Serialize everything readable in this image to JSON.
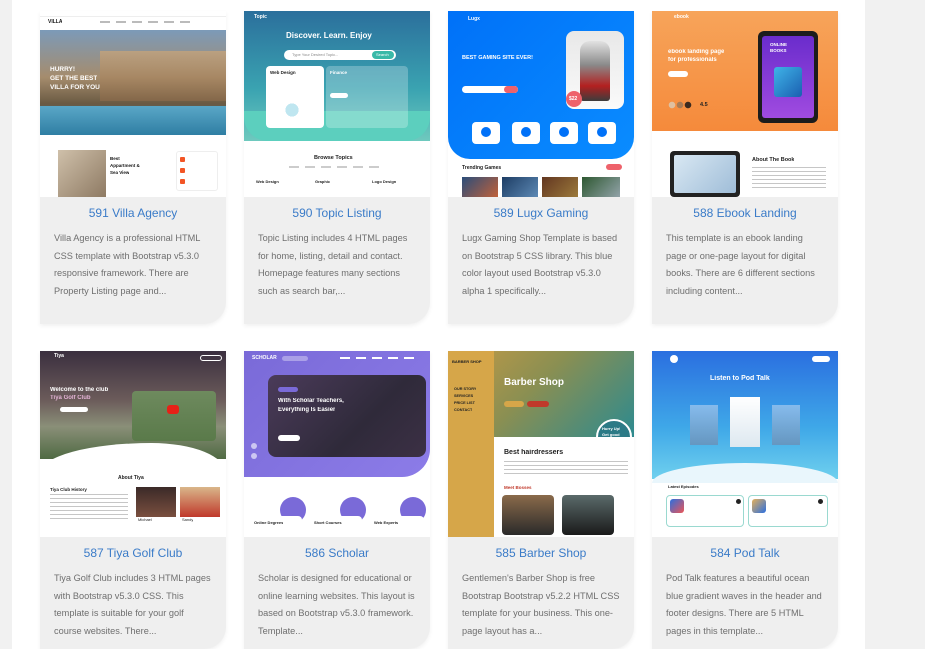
{
  "cards": [
    {
      "title": "591 Villa Agency",
      "description": "Villa Agency is a professional HTML CSS template with Bootstrap v5.3.0 responsive framework. There are Property Listing page and...",
      "thumb": {
        "brand": "VILLA",
        "hero": [
          "HURRY!",
          "GET THE BEST",
          "VILLA FOR YOU"
        ],
        "feature": [
          "Best",
          "Appartment &",
          "Sea View"
        ]
      }
    },
    {
      "title": "590 Topic Listing",
      "description": "Topic Listing includes 4 HTML pages for home, listing, detail and contact. Homepage features many sections such as search bar,...",
      "thumb": {
        "brand": "Topic",
        "hero": "Discover. Learn. Enjoy",
        "search_placeholder": "Type Your Desired Topic...",
        "search_button": "Search",
        "card1": "Web Design",
        "card2": "Finance",
        "section": "Browse Topics",
        "items": [
          "Web Design",
          "Graphic",
          "Logo Design"
        ]
      }
    },
    {
      "title": "589 Lugx Gaming",
      "description": "Lugx Gaming Shop Template is based on Bootstrap 5 CSS library. This blue color layout used Bootstrap v5.3.0 alpha 1 specifically...",
      "thumb": {
        "brand": "Lugx",
        "hero": "BEST GAMING SITE EVER!",
        "price": "$22",
        "section": "Trending Games"
      }
    },
    {
      "title": "588 Ebook Landing",
      "description": "This template is an ebook landing page or one-page layout for digital books. There are 6 different sections including content...",
      "thumb": {
        "brand": "ebook",
        "hero": [
          "ebook landing page",
          "for professionals"
        ],
        "rating": "4.5",
        "screen": [
          "ONLINE",
          "BOOKS"
        ],
        "section": "About The Book"
      }
    },
    {
      "title": "587 Tiya Golf Club",
      "description": "Tiya Golf Club includes 3 HTML pages with Bootstrap v5.3.0 CSS. This template is suitable for your golf course websites. There...",
      "thumb": {
        "brand": "Tiya",
        "hero": [
          "Welcome to the club",
          "Tiya Golf Club"
        ],
        "section": "About Tiya",
        "sub": "Tiya Club History",
        "people": [
          "Michael",
          "Sandy"
        ]
      }
    },
    {
      "title": "586 Scholar",
      "description": "Scholar is designed for educational or online learning websites. This layout is based on Bootstrap v5.3.0 framework. Template...",
      "thumb": {
        "brand": "SCHOLAR",
        "hero": [
          "With Scholar Teachers,",
          "Everything Is Easier"
        ],
        "items": [
          "Online Degrees",
          "Short Courses",
          "Web Experts"
        ]
      }
    },
    {
      "title": "585 Barber Shop",
      "description": "Gentlemen's Barber Shop is free Bootstrap Bootstrap v5.2.2 HTML CSS template for your business. This one-page layout has a...",
      "thumb": {
        "brand": "BARBER SHOP",
        "hero": "Barber Shop",
        "badge": [
          "Hurry Up!",
          "Get good",
          "haircut"
        ],
        "nav": [
          "OUR STORY",
          "SERVICES",
          "PRICE LIST",
          "CONTACT"
        ],
        "section": "Best hairdressers",
        "sub": "Meet Bosses"
      }
    },
    {
      "title": "584 Pod Talk",
      "description": "Pod Talk features a beautiful ocean blue gradient waves in the header and footer designs. There are 5 HTML pages in this template...",
      "thumb": {
        "hero": "Listen to Pod Talk",
        "section": "Latest Episodes"
      }
    }
  ]
}
